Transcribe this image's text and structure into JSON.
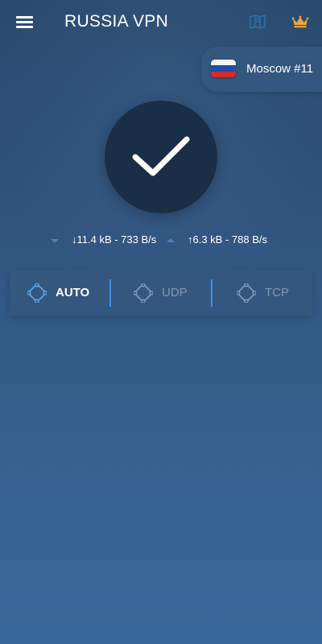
{
  "app": {
    "title": "RUSSIA VPN"
  },
  "header": {
    "menu_icon": "hamburger-menu-icon",
    "map_icon": "map-icon",
    "premium_icon": "crown-icon"
  },
  "server": {
    "name": "Moscow #11",
    "flag": "russia-flag",
    "flag_colors": [
      "#f4f4f4",
      "#1f4fa8",
      "#d62b2b"
    ]
  },
  "connection": {
    "status_icon": "checkmark-icon",
    "download": "↓11.4 kB - 733 B/s",
    "upload": "↑6.3 kB - 788 B/s"
  },
  "protocols": {
    "selected": "AUTO",
    "items": [
      {
        "label": "AUTO",
        "active": true
      },
      {
        "label": "UDP",
        "active": false
      },
      {
        "label": "TCP",
        "active": false
      }
    ]
  },
  "colors": {
    "accent": "#3f8ee8",
    "crown": "#f2a33a",
    "button_bg": "#1b2e47",
    "panel_bg": "#33577f",
    "inactive_text": "#8098b4"
  }
}
